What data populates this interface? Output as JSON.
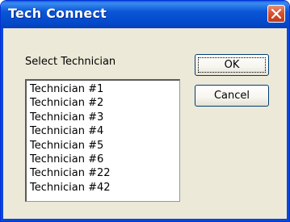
{
  "window": {
    "title": "Tech Connect",
    "colors": {
      "titlebar": "#0a55d7",
      "body": "#ece9d8",
      "close": "#d8532f"
    }
  },
  "dialog": {
    "prompt_label": "Select Technician",
    "technicians": [
      "Technician #1",
      "Technician #2",
      "Technician #3",
      "Technician #4",
      "Technician #5",
      "Technician #6",
      "Technician #22",
      "Technician #42"
    ],
    "buttons": {
      "ok_label": "OK",
      "cancel_label": "Cancel"
    }
  }
}
